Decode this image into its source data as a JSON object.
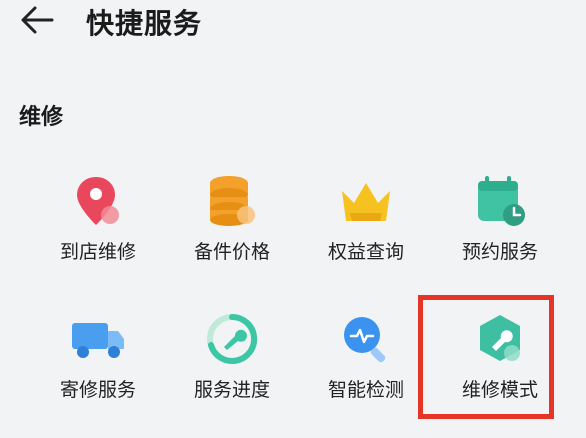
{
  "header": {
    "title": "快捷服务",
    "back_icon": "arrow-left-icon"
  },
  "section": {
    "title": "维修"
  },
  "services": [
    {
      "label": "到店维修",
      "icon": "location-pin-icon",
      "color": "#e9475c"
    },
    {
      "label": "备件价格",
      "icon": "coin-stack-icon",
      "color": "#f3a12a"
    },
    {
      "label": "权益查询",
      "icon": "crown-icon",
      "color": "#f6c21f"
    },
    {
      "label": "预约服务",
      "icon": "calendar-clock-icon",
      "color": "#3fc3a3"
    },
    {
      "label": "寄修服务",
      "icon": "truck-icon",
      "color": "#4a9ef0"
    },
    {
      "label": "服务进度",
      "icon": "progress-wrench-icon",
      "color": "#3cc6a6"
    },
    {
      "label": "智能检测",
      "icon": "search-pulse-icon",
      "color": "#3b93ef"
    },
    {
      "label": "维修模式",
      "icon": "hexagon-wrench-icon",
      "color": "#3fbfa2"
    }
  ],
  "highlight": {
    "color": "#e53527",
    "target": "维修模式"
  }
}
